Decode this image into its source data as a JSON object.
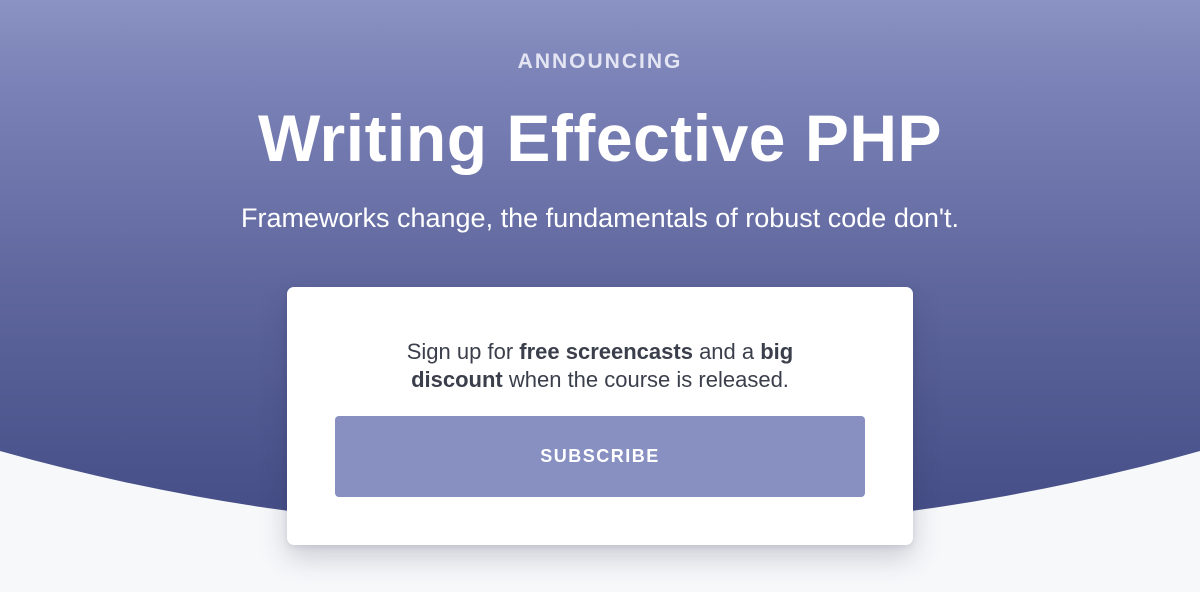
{
  "hero": {
    "eyebrow": "ANNOUNCING",
    "title": "Writing Effective PHP",
    "subtitle": "Frameworks change, the fundamentals of robust code don't."
  },
  "signup": {
    "text_1": "Sign up for ",
    "bold_1": "free screencasts",
    "text_2": " and a ",
    "bold_2": "big",
    "bold_3": "discount",
    "text_3": " when the course is released.",
    "button_label": "SUBSCRIBE"
  },
  "colors": {
    "hero_top": "#8b93c3",
    "hero_bottom": "#434c85",
    "button": "#8790c1",
    "page_bg": "#f7f8fa"
  }
}
